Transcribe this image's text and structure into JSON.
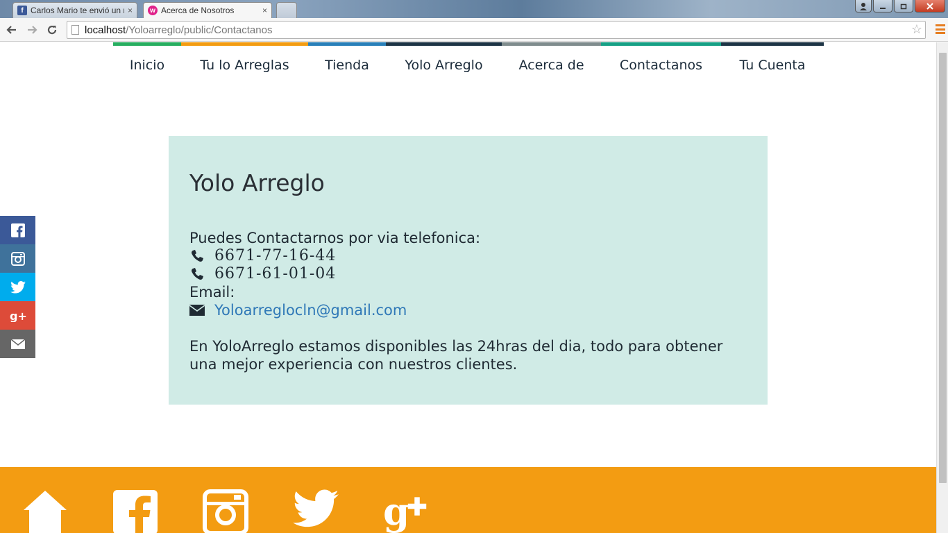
{
  "browser": {
    "tabs": [
      {
        "title": "Carlos Mario te envió un mensaje",
        "favicon": "facebook-favicon",
        "close": "×"
      },
      {
        "title": "Acerca de Nosotros",
        "favicon": "wix-favicon",
        "close": "×"
      }
    ],
    "url_host": "localhost",
    "url_path": "/Yoloarreglo/public/Contactanos"
  },
  "nav": {
    "items": [
      {
        "label": "Inicio",
        "color": "#27ae60"
      },
      {
        "label": "Tu lo Arreglas",
        "color": "#f39c12"
      },
      {
        "label": "Tienda",
        "color": "#2980b9"
      },
      {
        "label": "Yolo Arreglo",
        "color": "#1d3445"
      },
      {
        "label": "Acerca de",
        "color": "#7f8c8d"
      },
      {
        "label": "Contactanos",
        "color": "#16a085"
      },
      {
        "label": "Tu Cuenta",
        "color": "#1d3445"
      }
    ]
  },
  "social_sidebar": [
    {
      "icon": "facebook-icon",
      "color": "#3b5998"
    },
    {
      "icon": "instagram-icon",
      "color": "#3f729b"
    },
    {
      "icon": "twitter-icon",
      "color": "#00aced"
    },
    {
      "icon": "google-plus-icon",
      "color": "#dd4b39"
    },
    {
      "icon": "email-icon",
      "color": "#666666"
    }
  ],
  "contact": {
    "title": "Yolo Arreglo",
    "phone_intro": "Puedes Contactarnos por via telefonica:",
    "phones": [
      "6671-77-16-44",
      "6671-61-01-04"
    ],
    "email_label": "Email:",
    "email": "Yoloarreglocln@gmail.com",
    "description": "En YoloArreglo estamos disponibles las 24hras del dia, todo para obtener una mejor experiencia con nuestros clientes."
  },
  "footer": {
    "icons": [
      "home-icon",
      "facebook-icon",
      "instagram-icon",
      "twitter-icon",
      "google-plus-icon"
    ],
    "color": "#f39c12"
  }
}
